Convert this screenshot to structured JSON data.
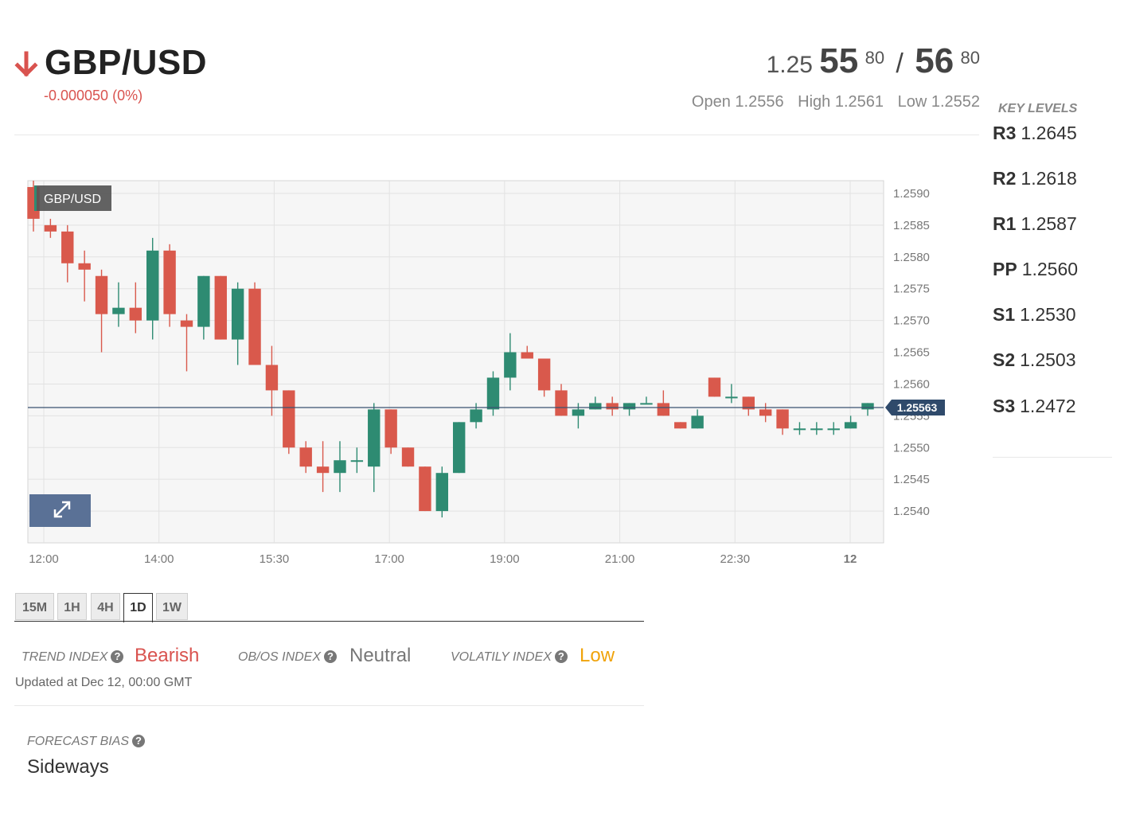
{
  "header": {
    "pair": "GBP/USD",
    "change": "-0.000050 (0%)",
    "bid_prefix": "1.25",
    "bid_big": "55",
    "bid_sup": "80",
    "ask_big": "56",
    "ask_sup": "80",
    "open": "Open 1.2556",
    "high": "High 1.2561",
    "low": "Low 1.2552"
  },
  "key_levels": {
    "title": "KEY LEVELS",
    "items": [
      {
        "name": "R3",
        "value": "1.2645"
      },
      {
        "name": "R2",
        "value": "1.2618"
      },
      {
        "name": "R1",
        "value": "1.2587"
      },
      {
        "name": "PP",
        "value": "1.2560"
      },
      {
        "name": "S1",
        "value": "1.2530"
      },
      {
        "name": "S2",
        "value": "1.2503"
      },
      {
        "name": "S3",
        "value": "1.2472"
      }
    ]
  },
  "tabs": [
    "15M",
    "1H",
    "4H",
    "1D",
    "1W"
  ],
  "active_tab": "1D",
  "indices": {
    "trend_label": "TREND INDEX",
    "trend_value": "Bearish",
    "obos_label": "OB/OS INDEX",
    "obos_value": "Neutral",
    "vol_label": "VOLATILY INDEX",
    "vol_value": "Low",
    "updated": "Updated at Dec 12, 00:00 GMT"
  },
  "forecast": {
    "label": "FORECAST BIAS",
    "value": "Sideways"
  },
  "colors": {
    "bearish": "#d9534f",
    "up_candle": "#2e8b72",
    "down_candle": "#d9594c",
    "low": "#f0a30a",
    "price_line": "#3a5270"
  },
  "chart_data": {
    "type": "candlestick",
    "series_name": "GBP/USD",
    "x_tick_labels": [
      "12:00",
      "14:00",
      "15:30",
      "17:00",
      "19:00",
      "21:00",
      "22:30",
      "12"
    ],
    "y_tick_labels": [
      "1.2590",
      "1.2585",
      "1.2580",
      "1.2575",
      "1.2570",
      "1.2565",
      "1.2560",
      "1.2555",
      "1.2550",
      "1.2545",
      "1.2540"
    ],
    "ylim": [
      1.2535,
      1.2592
    ],
    "last_price": 1.25563,
    "last_price_label": "1.25563",
    "candles": [
      [
        1.2591,
        1.2592,
        1.2584,
        1.2586
      ],
      [
        1.2585,
        1.2586,
        1.2583,
        1.2584
      ],
      [
        1.2584,
        1.2585,
        1.2576,
        1.2579
      ],
      [
        1.2579,
        1.2581,
        1.2573,
        1.2578
      ],
      [
        1.2577,
        1.2578,
        1.2565,
        1.2571
      ],
      [
        1.2571,
        1.2576,
        1.2569,
        1.2572
      ],
      [
        1.2572,
        1.2576,
        1.2568,
        1.257
      ],
      [
        1.257,
        1.2583,
        1.2567,
        1.2581
      ],
      [
        1.2581,
        1.2582,
        1.2569,
        1.2571
      ],
      [
        1.257,
        1.2571,
        1.2562,
        1.2569
      ],
      [
        1.2569,
        1.2577,
        1.2567,
        1.2577
      ],
      [
        1.2577,
        1.2577,
        1.2567,
        1.2567
      ],
      [
        1.2567,
        1.2576,
        1.2563,
        1.2575
      ],
      [
        1.2575,
        1.2576,
        1.2563,
        1.2563
      ],
      [
        1.2563,
        1.2566,
        1.2555,
        1.2559
      ],
      [
        1.2559,
        1.2559,
        1.2549,
        1.255
      ],
      [
        1.255,
        1.2551,
        1.2546,
        1.2547
      ],
      [
        1.2547,
        1.2551,
        1.2543,
        1.2546
      ],
      [
        1.2546,
        1.2551,
        1.2543,
        1.2548
      ],
      [
        1.2548,
        1.255,
        1.2546,
        1.2548
      ],
      [
        1.2547,
        1.2557,
        1.2543,
        1.2556
      ],
      [
        1.2556,
        1.2556,
        1.2549,
        1.255
      ],
      [
        1.255,
        1.255,
        1.2547,
        1.2547
      ],
      [
        1.2547,
        1.2547,
        1.254,
        1.254
      ],
      [
        1.254,
        1.2547,
        1.2539,
        1.2546
      ],
      [
        1.2546,
        1.2554,
        1.2546,
        1.2554
      ],
      [
        1.2554,
        1.2557,
        1.2553,
        1.2556
      ],
      [
        1.2556,
        1.2562,
        1.2555,
        1.2561
      ],
      [
        1.2561,
        1.2568,
        1.2559,
        1.2565
      ],
      [
        1.2565,
        1.2566,
        1.2564,
        1.2564
      ],
      [
        1.2564,
        1.2564,
        1.2558,
        1.2559
      ],
      [
        1.2559,
        1.256,
        1.2555,
        1.2555
      ],
      [
        1.2555,
        1.2557,
        1.2553,
        1.2556
      ],
      [
        1.2556,
        1.2558,
        1.2556,
        1.2557
      ],
      [
        1.2557,
        1.2558,
        1.2555,
        1.2556
      ],
      [
        1.2556,
        1.2557,
        1.2555,
        1.2557
      ],
      [
        1.2557,
        1.2558,
        1.2557,
        1.2557
      ],
      [
        1.2557,
        1.2559,
        1.2555,
        1.2555
      ],
      [
        1.2554,
        1.2554,
        1.2553,
        1.2553
      ],
      [
        1.2553,
        1.2556,
        1.2553,
        1.2555
      ],
      [
        1.2561,
        1.2561,
        1.2558,
        1.2558
      ],
      [
        1.2558,
        1.256,
        1.2557,
        1.2558
      ],
      [
        1.2558,
        1.2558,
        1.2555,
        1.2556
      ],
      [
        1.2556,
        1.2557,
        1.2554,
        1.2555
      ],
      [
        1.2556,
        1.2556,
        1.2552,
        1.2553
      ],
      [
        1.2553,
        1.2554,
        1.2552,
        1.2553
      ],
      [
        1.2553,
        1.2554,
        1.2552,
        1.2553
      ],
      [
        1.2553,
        1.2554,
        1.2552,
        1.2553
      ],
      [
        1.2553,
        1.2555,
        1.2553,
        1.2554
      ],
      [
        1.2556,
        1.2557,
        1.2555,
        1.2557
      ]
    ]
  }
}
